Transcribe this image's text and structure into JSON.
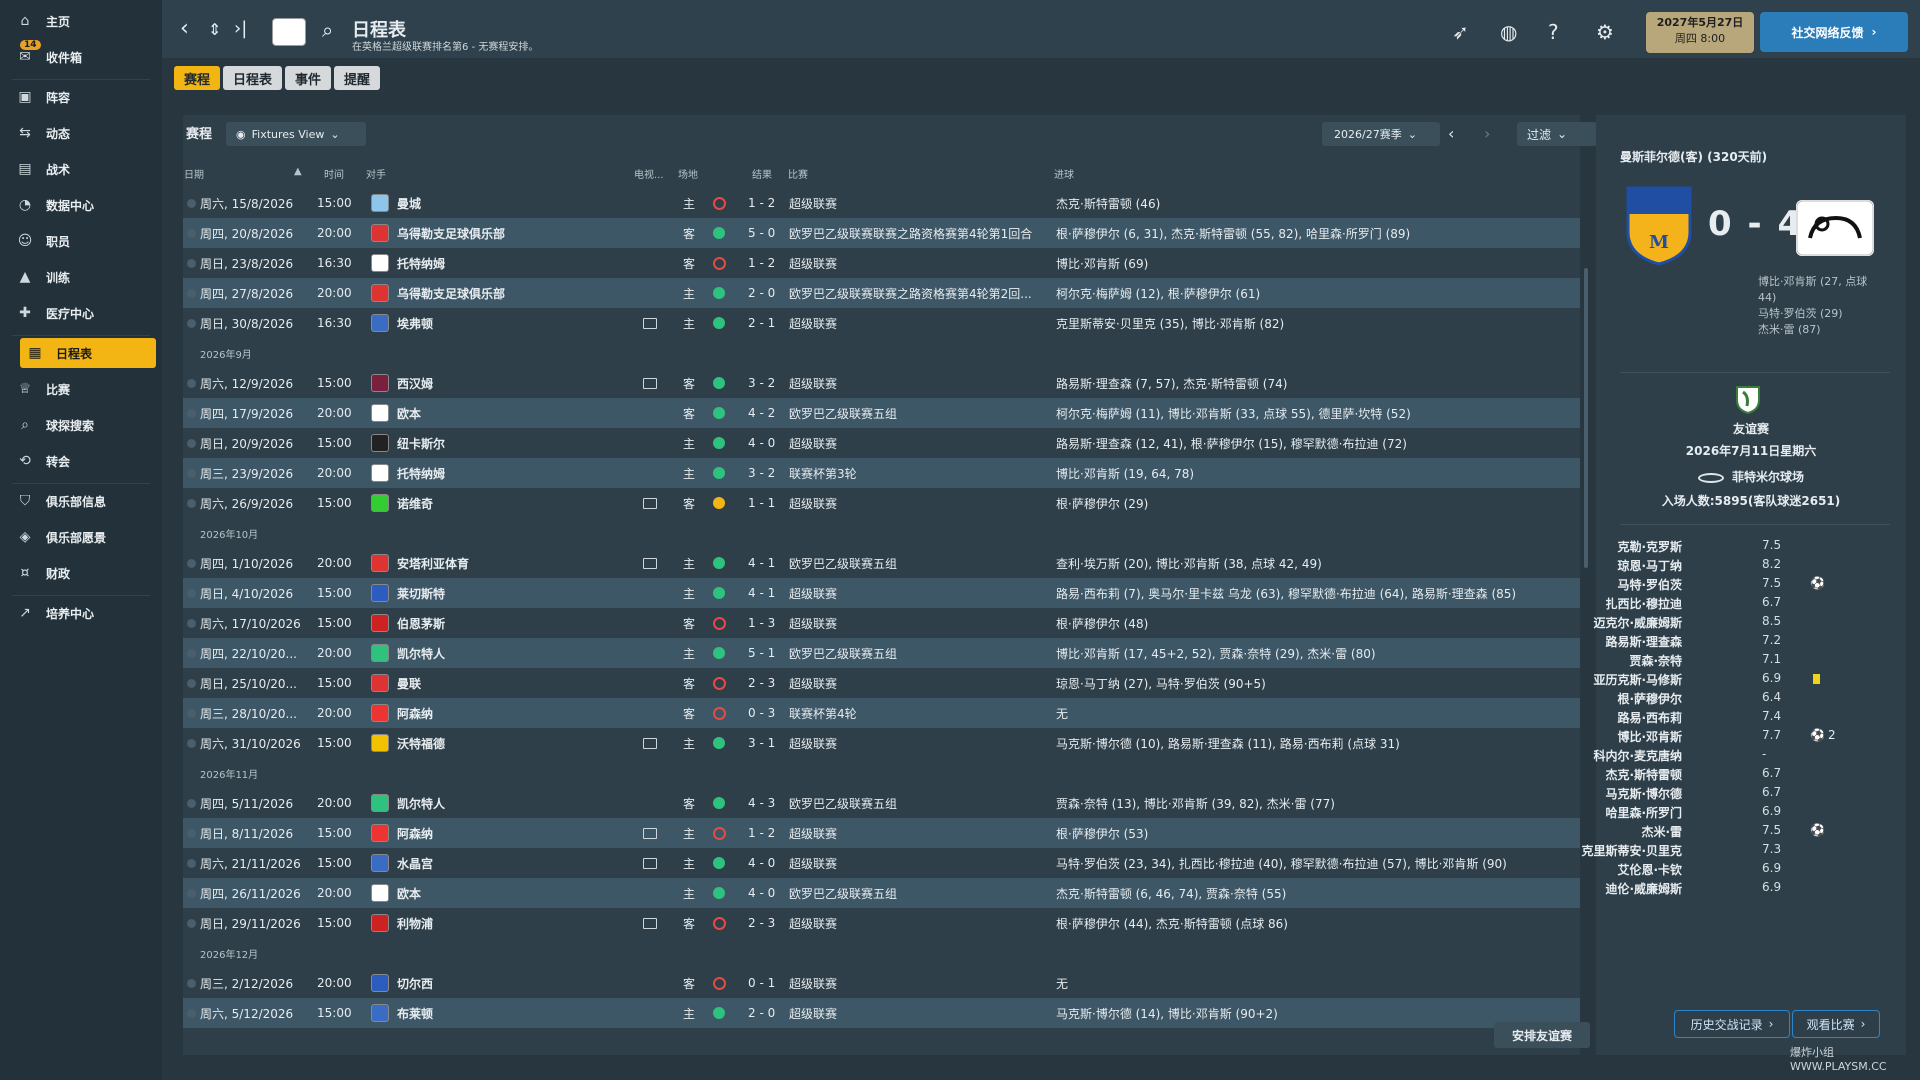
{
  "sidebar": {
    "items": [
      {
        "label": "主页",
        "icon": "home-icon"
      },
      {
        "label": "收件箱",
        "icon": "inbox-icon",
        "badge": "14"
      },
      {
        "label": "阵容",
        "icon": "shirt-icon"
      },
      {
        "label": "动态",
        "icon": "dynamics-icon"
      },
      {
        "label": "战术",
        "icon": "tactics-icon"
      },
      {
        "label": "数据中心",
        "icon": "data-hub-icon"
      },
      {
        "label": "职员",
        "icon": "staff-icon"
      },
      {
        "label": "训练",
        "icon": "training-icon"
      },
      {
        "label": "医疗中心",
        "icon": "medical-icon"
      },
      {
        "label": "日程表",
        "icon": "calendar-icon",
        "active": true
      },
      {
        "label": "比赛",
        "icon": "trophy-icon"
      },
      {
        "label": "球探搜索",
        "icon": "search-icon"
      },
      {
        "label": "转会",
        "icon": "transfer-icon"
      },
      {
        "label": "俱乐部信息",
        "icon": "shield-icon"
      },
      {
        "label": "俱乐部愿景",
        "icon": "vision-icon"
      },
      {
        "label": "财政",
        "icon": "finance-icon"
      },
      {
        "label": "培养中心",
        "icon": "development-icon"
      }
    ]
  },
  "header": {
    "title": "日程表",
    "subtitle": "在英格兰超级联赛排名第6 - 无赛程安排。",
    "date_line1": "2027年5月27日",
    "date_line2": "周四 8:00",
    "feedback": "社交网络反馈"
  },
  "tabs": [
    "赛程",
    "日程表",
    "事件",
    "提醒"
  ],
  "panel": {
    "title": "赛程",
    "view": "Fixtures View",
    "season": "2026/27赛季",
    "filter": "过滤",
    "columns": {
      "date": "日期",
      "time": "时间",
      "opponent": "对手",
      "tv": "电视...",
      "venue": "场地",
      "result": "结果",
      "competition": "比赛",
      "goals": "进球"
    },
    "arrange_friendly": "安排友谊赛"
  },
  "fixtures": [
    {
      "type": "row",
      "date": "周六, 15/8/2026",
      "time": "15:00",
      "opp": "曼城",
      "tv": false,
      "venue": "主",
      "res": "loss",
      "score": "1 - 2",
      "comp": "超级联赛",
      "goals": "杰克·斯特雷顿 (46)",
      "color": "#8ec5ea"
    },
    {
      "type": "row",
      "date": "周四, 20/8/2026",
      "time": "20:00",
      "opp": "乌得勒支足球俱乐部",
      "tv": false,
      "venue": "客",
      "res": "win",
      "score": "5 - 0",
      "comp": "欧罗巴乙级联赛联赛之路资格赛第4轮第1回合",
      "goals": "根·萨穆伊尔 (6, 31), 杰克·斯特雷顿 (55, 82), 哈里森·所罗门 (89)",
      "color": "#d33"
    },
    {
      "type": "row",
      "date": "周日, 23/8/2026",
      "time": "16:30",
      "opp": "托特纳姆",
      "tv": false,
      "venue": "客",
      "res": "loss",
      "score": "1 - 2",
      "comp": "超级联赛",
      "goals": "博比·邓肯斯 (69)",
      "color": "#fff"
    },
    {
      "type": "row",
      "date": "周四, 27/8/2026",
      "time": "20:00",
      "opp": "乌得勒支足球俱乐部",
      "tv": false,
      "venue": "主",
      "res": "win",
      "score": "2 - 0",
      "comp": "欧罗巴乙级联赛联赛之路资格赛第4轮第2回...",
      "goals": "柯尔克·梅萨姆 (12), 根·萨穆伊尔 (61)",
      "color": "#d33"
    },
    {
      "type": "row",
      "date": "周日, 30/8/2026",
      "time": "16:30",
      "opp": "埃弗顿",
      "tv": true,
      "venue": "主",
      "res": "win",
      "score": "2 - 1",
      "comp": "超级联赛",
      "goals": "克里斯蒂安·贝里克 (35), 博比·邓肯斯 (82)",
      "color": "#3b6cc4"
    },
    {
      "type": "month",
      "label": "2026年9月"
    },
    {
      "type": "row",
      "date": "周六, 12/9/2026",
      "time": "15:00",
      "opp": "西汉姆",
      "tv": true,
      "venue": "客",
      "res": "win",
      "score": "3 - 2",
      "comp": "超级联赛",
      "goals": "路易斯·理查森 (7, 57), 杰克·斯特雷顿 (74)",
      "color": "#7a1f3d"
    },
    {
      "type": "row",
      "date": "周四, 17/9/2026",
      "time": "20:00",
      "opp": "欧本",
      "tv": false,
      "venue": "客",
      "res": "win",
      "score": "4 - 2",
      "comp": "欧罗巴乙级联赛五组",
      "goals": "柯尔克·梅萨姆 (11), 博比·邓肯斯 (33, 点球 55), 德里萨·坎特 (52)",
      "color": "#fff"
    },
    {
      "type": "row",
      "date": "周日, 20/9/2026",
      "time": "15:00",
      "opp": "纽卡斯尔",
      "tv": false,
      "venue": "主",
      "res": "win",
      "score": "4 - 0",
      "comp": "超级联赛",
      "goals": "路易斯·理查森 (12, 41), 根·萨穆伊尔 (15), 穆罕默德·布拉迪 (72)",
      "color": "#222"
    },
    {
      "type": "row",
      "date": "周三, 23/9/2026",
      "time": "20:00",
      "opp": "托特纳姆",
      "tv": false,
      "venue": "主",
      "res": "win",
      "score": "3 - 2",
      "comp": "联赛杯第3轮",
      "goals": "博比·邓肯斯 (19, 64, 78)",
      "color": "#fff"
    },
    {
      "type": "row",
      "date": "周六, 26/9/2026",
      "time": "15:00",
      "opp": "诺维奇",
      "tv": true,
      "venue": "客",
      "res": "draw",
      "score": "1 - 1",
      "comp": "超级联赛",
      "goals": "根·萨穆伊尔 (29)",
      "color": "#3c3"
    },
    {
      "type": "month",
      "label": "2026年10月"
    },
    {
      "type": "row",
      "date": "周四, 1/10/2026",
      "time": "20:00",
      "opp": "安塔利亚体育",
      "tv": true,
      "venue": "主",
      "res": "win",
      "score": "4 - 1",
      "comp": "欧罗巴乙级联赛五组",
      "goals": "查利·埃万斯 (20), 博比·邓肯斯 (38, 点球 42, 49)",
      "color": "#d33"
    },
    {
      "type": "row",
      "date": "周日, 4/10/2026",
      "time": "15:00",
      "opp": "莱切斯特",
      "tv": false,
      "venue": "主",
      "res": "win",
      "score": "4 - 1",
      "comp": "超级联赛",
      "goals": "路易·西布莉 (7), 奥马尔·里卡兹 乌龙 (63), 穆罕默德·布拉迪 (64), 路易斯·理查森 (85)",
      "color": "#2d5cbf"
    },
    {
      "type": "row",
      "date": "周六, 17/10/2026",
      "time": "15:00",
      "opp": "伯恩茅斯",
      "tv": false,
      "venue": "客",
      "res": "loss",
      "score": "1 - 3",
      "comp": "超级联赛",
      "goals": "根·萨穆伊尔 (48)",
      "color": "#c22"
    },
    {
      "type": "row",
      "date": "周四, 22/10/20...",
      "time": "20:00",
      "opp": "凯尔特人",
      "tv": false,
      "venue": "主",
      "res": "win",
      "score": "5 - 1",
      "comp": "欧罗巴乙级联赛五组",
      "goals": "博比·邓肯斯 (17, 45+2, 52), 贾森·奈特 (29), 杰米·雷 (80)",
      "color": "#2ec27e"
    },
    {
      "type": "row",
      "date": "周日, 25/10/20...",
      "time": "15:00",
      "opp": "曼联",
      "tv": false,
      "venue": "客",
      "res": "loss",
      "score": "2 - 3",
      "comp": "超级联赛",
      "goals": "琼恩·马丁纳 (27), 马特·罗伯茨 (90+5)",
      "color": "#d33"
    },
    {
      "type": "row",
      "date": "周三, 28/10/20...",
      "time": "20:00",
      "opp": "阿森纳",
      "tv": false,
      "venue": "客",
      "res": "loss",
      "score": "0 - 3",
      "comp": "联赛杯第4轮",
      "goals": "无",
      "color": "#e33"
    },
    {
      "type": "row",
      "date": "周六, 31/10/2026",
      "time": "15:00",
      "opp": "沃特福德",
      "tv": true,
      "venue": "主",
      "res": "win",
      "score": "3 - 1",
      "comp": "超级联赛",
      "goals": "马克斯·博尔德 (10), 路易斯·理查森 (11), 路易·西布莉 (点球 31)",
      "color": "#f2c200"
    },
    {
      "type": "month",
      "label": "2026年11月"
    },
    {
      "type": "row",
      "date": "周四, 5/11/2026",
      "time": "20:00",
      "opp": "凯尔特人",
      "tv": false,
      "venue": "客",
      "res": "win",
      "score": "4 - 3",
      "comp": "欧罗巴乙级联赛五组",
      "goals": "贾森·奈特 (13), 博比·邓肯斯 (39, 82), 杰米·雷 (77)",
      "color": "#2ec27e"
    },
    {
      "type": "row",
      "date": "周日, 8/11/2026",
      "time": "15:00",
      "opp": "阿森纳",
      "tv": true,
      "venue": "主",
      "res": "loss",
      "score": "1 - 2",
      "comp": "超级联赛",
      "goals": "根·萨穆伊尔 (53)",
      "color": "#e33"
    },
    {
      "type": "row",
      "date": "周六, 21/11/2026",
      "time": "15:00",
      "opp": "水晶宫",
      "tv": true,
      "venue": "主",
      "res": "win",
      "score": "4 - 0",
      "comp": "超级联赛",
      "goals": "马特·罗伯茨 (23, 34), 扎西比·穆拉迪 (40), 穆罕默德·布拉迪 (57), 博比·邓肯斯 (90)",
      "color": "#3b6cc4"
    },
    {
      "type": "row",
      "date": "周四, 26/11/2026",
      "time": "20:00",
      "opp": "欧本",
      "tv": false,
      "venue": "主",
      "res": "win",
      "score": "4 - 0",
      "comp": "欧罗巴乙级联赛五组",
      "goals": "杰克·斯特雷顿 (6, 46, 74), 贾森·奈特 (55)",
      "color": "#fff"
    },
    {
      "type": "row",
      "date": "周日, 29/11/2026",
      "time": "15:00",
      "opp": "利物浦",
      "tv": true,
      "venue": "客",
      "res": "loss",
      "score": "2 - 3",
      "comp": "超级联赛",
      "goals": "根·萨穆伊尔 (44), 杰克·斯特雷顿 (点球 86)",
      "color": "#c22"
    },
    {
      "type": "month",
      "label": "2026年12月"
    },
    {
      "type": "row",
      "date": "周三, 2/12/2026",
      "time": "20:00",
      "opp": "切尔西",
      "tv": false,
      "venue": "客",
      "res": "loss",
      "score": "0 - 1",
      "comp": "超级联赛",
      "goals": "无",
      "color": "#2d5cbf"
    },
    {
      "type": "row",
      "date": "周六, 5/12/2026",
      "time": "15:00",
      "opp": "布莱顿",
      "tv": false,
      "venue": "主",
      "res": "win",
      "score": "2 - 0",
      "comp": "超级联赛",
      "goals": "马克斯·博尔德 (14), 博比·邓肯斯 (90+2)",
      "color": "#3b6cc4"
    }
  ],
  "match_panel": {
    "title": "曼斯菲尔德(客) (320天前)",
    "score": "0 - 4",
    "scorers": [
      "博比·邓肯斯 (27, 点球 44)",
      "马特·罗伯茨 (29)",
      "杰米·雷 (87)"
    ],
    "competition": "友谊赛",
    "date": "2026年7月11日星期六",
    "stadium": "菲特米尔球场",
    "attendance": "入场人数:5895(客队球迷2651)",
    "players": [
      {
        "name": "克勒·克罗斯",
        "rating": "7.5",
        "extra": ""
      },
      {
        "name": "琼恩·马丁纳",
        "rating": "8.2",
        "extra": ""
      },
      {
        "name": "马特·罗伯茨",
        "rating": "7.5",
        "extra": "ball"
      },
      {
        "name": "扎西比·穆拉迪",
        "rating": "6.7",
        "extra": ""
      },
      {
        "name": "迈克尔·威廉姆斯",
        "rating": "8.5",
        "extra": ""
      },
      {
        "name": "路易斯·理查森",
        "rating": "7.2",
        "extra": ""
      },
      {
        "name": "贾森·奈特",
        "rating": "7.1",
        "extra": ""
      },
      {
        "name": "亚历克斯·马修斯",
        "rating": "6.9",
        "extra": "yellow"
      },
      {
        "name": "根·萨穆伊尔",
        "rating": "6.4",
        "extra": ""
      },
      {
        "name": "路易·西布莉",
        "rating": "7.4",
        "extra": ""
      },
      {
        "name": "博比·邓肯斯",
        "rating": "7.7",
        "extra": "ball2"
      },
      {
        "name": "科内尔·麦克唐纳",
        "rating": "-",
        "extra": ""
      },
      {
        "name": "杰克·斯特雷顿",
        "rating": "6.7",
        "extra": ""
      },
      {
        "name": "马克斯·博尔德",
        "rating": "6.7",
        "extra": ""
      },
      {
        "name": "哈里森·所罗门",
        "rating": "6.9",
        "extra": ""
      },
      {
        "name": "杰米·雷",
        "rating": "7.5",
        "extra": "ball"
      },
      {
        "name": "克里斯蒂安·贝里克",
        "rating": "7.3",
        "extra": ""
      },
      {
        "name": "艾伦恩·卡钦",
        "rating": "6.9",
        "extra": ""
      },
      {
        "name": "迪伦·威廉姆斯",
        "rating": "6.9",
        "extra": ""
      }
    ],
    "ball_count": "2",
    "history_btn": "历史交战记录",
    "watch_btn": "观看比赛"
  },
  "watermark": "爆炸小组 WWW.PLAYSM.CC"
}
